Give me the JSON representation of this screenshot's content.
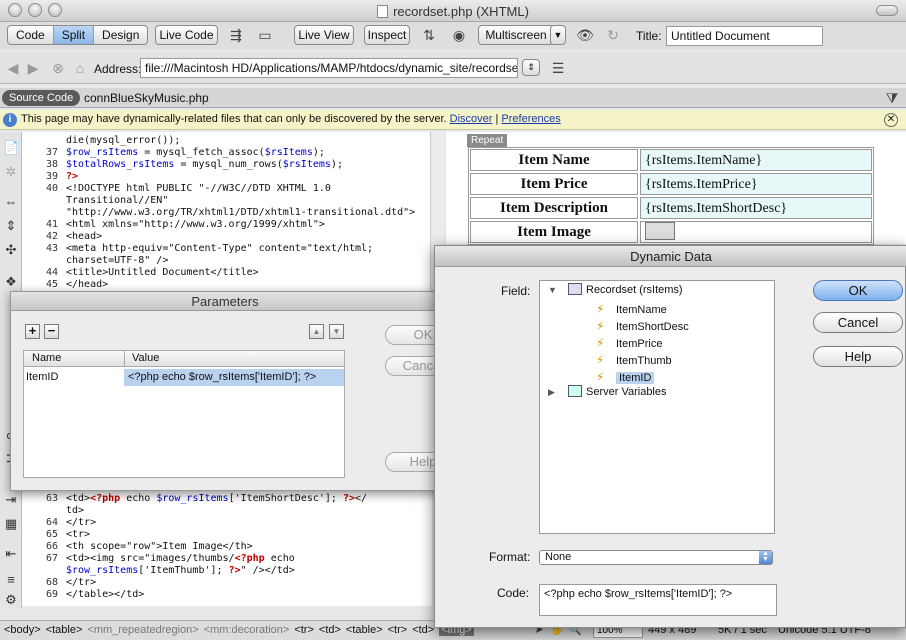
{
  "window": {
    "title": "recordset.php (XHTML)"
  },
  "toolbar": {
    "view_buttons": [
      "Code",
      "Split",
      "Design"
    ],
    "live_code": "Live Code",
    "live_view": "Live View",
    "inspect": "Inspect",
    "multiscreen": "Multiscreen",
    "title_label": "Title:",
    "title_value": "Untitled Document"
  },
  "address": {
    "label": "Address:",
    "value": "file:///Macintosh HD/Applications/MAMP/htdocs/dynamic_site/recordset.php"
  },
  "related_files": {
    "source_code": "Source Code",
    "file": "connBlueSkyMusic.php"
  },
  "infobar": {
    "text": "This page may have dynamically-related files that can only be discovered by the server.",
    "discover": "Discover",
    "separator": "|",
    "preferences": "Preferences"
  },
  "code_top": [
    {
      "n": "",
      "t": "die(mysql_error());"
    },
    {
      "n": "37",
      "t": "$row_rsItems = mysql_fetch_assoc($rsItems);"
    },
    {
      "n": "38",
      "t": "$totalRows_rsItems = mysql_num_rows($rsItems);"
    },
    {
      "n": "39",
      "t": "?>"
    },
    {
      "n": "40",
      "t": "<!DOCTYPE html PUBLIC \"-//W3C//DTD XHTML 1.0"
    },
    {
      "n": "",
      "t": "Transitional//EN\""
    },
    {
      "n": "",
      "t": "\"http://www.w3.org/TR/xhtml1/DTD/xhtml1-transitional.dtd\">"
    },
    {
      "n": "41",
      "t": "<html xmlns=\"http://www.w3.org/1999/xhtml\">"
    },
    {
      "n": "42",
      "t": "<head>"
    },
    {
      "n": "43",
      "t": "<meta http-equiv=\"Content-Type\" content=\"text/html;"
    },
    {
      "n": "",
      "t": "charset=UTF-8\" />"
    },
    {
      "n": "44",
      "t": "<title>Untitled Document</title>"
    },
    {
      "n": "45",
      "t": "</head>"
    }
  ],
  "code_bottom": [
    {
      "n": "63",
      "t": "        <td><?php echo $row_rsItems['ItemShortDesc']; ?></"
    },
    {
      "n": "",
      "t": "td>"
    },
    {
      "n": "64",
      "t": "        </tr>"
    },
    {
      "n": "65",
      "t": "      <tr>"
    },
    {
      "n": "66",
      "t": "        <th scope=\"row\">Item Image</th>"
    },
    {
      "n": "67",
      "t": "        <td><img src=\"images/thumbs/<?php echo"
    },
    {
      "n": "",
      "t": "$row_rsItems['ItemThumb']; ?>\" /></td>"
    },
    {
      "n": "68",
      "t": "        </tr>"
    },
    {
      "n": "69",
      "t": "    </table></td>"
    }
  ],
  "design": {
    "repeat_tag": "Repeat",
    "rows": [
      {
        "label": "Item Name",
        "value": "{rsItems.ItemName}"
      },
      {
        "label": "Item Price",
        "value": "{rsItems.ItemPrice}"
      },
      {
        "label": "Item Description",
        "value": "{rsItems.ItemShortDesc}"
      },
      {
        "label": "Item Image",
        "value": ""
      }
    ]
  },
  "parameters": {
    "title": "Parameters",
    "columns": [
      "Name",
      "Value"
    ],
    "row": {
      "name": "ItemID",
      "value": "<?php echo $row_rsItems['ItemID']; ?>"
    },
    "ok": "OK",
    "cancel": "Cancel",
    "help": "Help"
  },
  "dynamic_data": {
    "title": "Dynamic Data",
    "field_label": "Field:",
    "recordset": "Recordset (rsItems)",
    "fields": [
      "ItemName",
      "ItemShortDesc",
      "ItemPrice",
      "ItemThumb",
      "ItemID"
    ],
    "selected": "ItemID",
    "server_vars": "Server Variables",
    "ok": "OK",
    "cancel": "Cancel",
    "help": "Help",
    "format_label": "Format:",
    "format_value": "None",
    "code_label": "Code:",
    "code_value": "<?php echo $row_rsItems['ItemID']; ?>"
  },
  "status": {
    "tags": [
      "<body>",
      "<table>",
      "<mm_repeatedregion>",
      "<mm:decoration>",
      "<tr>",
      "<td>",
      "<table>",
      "<tr>",
      "<td>",
      "<img>"
    ],
    "zoom": "100%",
    "dims": "449 x 489",
    "size": "5K / 1 sec",
    "encoding": "Unicode 5.1 UTF-8"
  }
}
